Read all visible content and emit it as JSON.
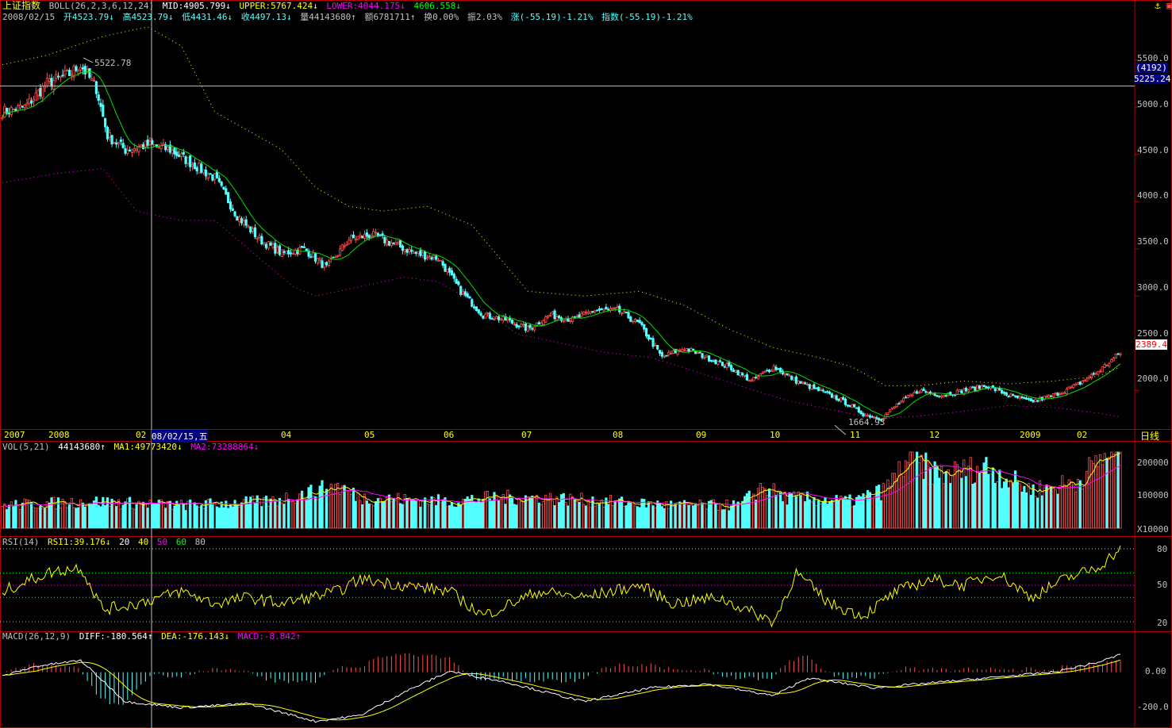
{
  "window": {
    "icons": [
      "anchor-icon",
      "calendar-icon"
    ]
  },
  "header": {
    "index_name": "上证指数",
    "boll_label": "BOLL(26,2,3,6,12,24)",
    "mid": "MID:4905.799↓",
    "upper": "UPPER:5767.424↓",
    "lower": "LOWER:4044.175↓",
    "extra": "4606.558↓",
    "date": "2008/02/15",
    "open": "开4523.79↓",
    "high": "高4523.79↓",
    "low": "低4431.46↓",
    "close": "收4497.13↓",
    "volume": "量44143680↑",
    "amount": "额6781711↑",
    "turnover": "换0.00%",
    "amplitude": "振2.03%",
    "change": "涨(-55.19)-1.21%",
    "index_change": "指数(-55.19)-1.21%"
  },
  "price_axis": {
    "ticks": [
      "5500.0",
      "5000.0",
      "4500.0",
      "4000.0",
      "3500.0",
      "3000.0",
      "2500.0",
      "2000.0"
    ],
    "cursor_box_top": "(4192)",
    "cursor_box_value": "5225.24",
    "last_price": "2389.4"
  },
  "annotations": {
    "high_label": "5522.78",
    "low_label": "1664.93"
  },
  "time_axis": {
    "labels": [
      "2007",
      "2008",
      "02",
      "04",
      "05",
      "06",
      "07",
      "08",
      "09",
      "10",
      "11",
      "12",
      "2009",
      "02"
    ],
    "cursor_date": "08/02/15,五",
    "period": "日线"
  },
  "vol_panel": {
    "title": "VOL(5,21)",
    "value": "44143680↑",
    "ma1": "MA1:49773420↓",
    "ma2": "MA2:73288864↓",
    "ticks": [
      "200000",
      "100000"
    ],
    "unit": "X10000"
  },
  "rsi_panel": {
    "title": "RSI(14)",
    "rsi1": "RSI1:39.176↓",
    "levels_text": [
      "20",
      "40",
      "50",
      "60",
      "80"
    ],
    "ticks": [
      "80",
      "50",
      "20"
    ]
  },
  "macd_panel": {
    "title": "MACD(26,12,9)",
    "diff": "DIFF:-180.564↑",
    "dea": "DEA:-176.143↓",
    "macd": "MACD:-8.842↑",
    "ticks": [
      "0.00",
      "-200.0"
    ]
  },
  "colors": {
    "up": "#ff5050",
    "down": "#54ffff",
    "mid": "#00e000",
    "upper": "#ffff00",
    "lower": "#ff00ff",
    "grid": "#b00000"
  },
  "chart_data": {
    "type": "candlestick",
    "price_anchors": [
      [
        0,
        4950
      ],
      [
        10,
        5000
      ],
      [
        20,
        5250
      ],
      [
        30,
        5350
      ],
      [
        35,
        5450
      ],
      [
        42,
        5200
      ],
      [
        47,
        4700
      ],
      [
        55,
        4550
      ],
      [
        65,
        4600
      ],
      [
        75,
        4550
      ],
      [
        85,
        4400
      ],
      [
        95,
        4250
      ],
      [
        105,
        3850
      ],
      [
        115,
        3600
      ],
      [
        125,
        3450
      ],
      [
        135,
        3500
      ],
      [
        145,
        3300
      ],
      [
        155,
        3600
      ],
      [
        165,
        3650
      ],
      [
        175,
        3550
      ],
      [
        185,
        3450
      ],
      [
        195,
        3400
      ],
      [
        205,
        3050
      ],
      [
        215,
        2800
      ],
      [
        225,
        2750
      ],
      [
        235,
        2650
      ],
      [
        245,
        2800
      ],
      [
        255,
        2750
      ],
      [
        265,
        2850
      ],
      [
        275,
        2850
      ],
      [
        285,
        2700
      ],
      [
        295,
        2350
      ],
      [
        305,
        2450
      ],
      [
        315,
        2350
      ],
      [
        325,
        2250
      ],
      [
        335,
        2100
      ],
      [
        345,
        2250
      ],
      [
        355,
        2100
      ],
      [
        365,
        2000
      ],
      [
        375,
        1900
      ],
      [
        385,
        1750
      ],
      [
        393,
        1700
      ],
      [
        400,
        1850
      ],
      [
        410,
        2000
      ],
      [
        420,
        1950
      ],
      [
        430,
        2000
      ],
      [
        440,
        2050
      ],
      [
        450,
        1950
      ],
      [
        460,
        1880
      ],
      [
        470,
        1950
      ],
      [
        480,
        2050
      ],
      [
        490,
        2200
      ],
      [
        500,
        2400
      ]
    ],
    "boll_upper_anchors": [
      [
        0,
        5450
      ],
      [
        20,
        5550
      ],
      [
        45,
        5750
      ],
      [
        65,
        5850
      ],
      [
        80,
        5650
      ],
      [
        95,
        4950
      ],
      [
        110,
        4750
      ],
      [
        125,
        4550
      ],
      [
        140,
        4150
      ],
      [
        155,
        3950
      ],
      [
        170,
        3900
      ],
      [
        190,
        3950
      ],
      [
        210,
        3750
      ],
      [
        235,
        3050
      ],
      [
        260,
        3000
      ],
      [
        285,
        3050
      ],
      [
        305,
        2900
      ],
      [
        325,
        2650
      ],
      [
        345,
        2450
      ],
      [
        365,
        2350
      ],
      [
        380,
        2250
      ],
      [
        395,
        2050
      ],
      [
        410,
        2050
      ],
      [
        430,
        2100
      ],
      [
        450,
        2070
      ],
      [
        470,
        2100
      ],
      [
        490,
        2150
      ],
      [
        500,
        2250
      ]
    ],
    "boll_lower_anchors": [
      [
        0,
        4200
      ],
      [
        25,
        4300
      ],
      [
        45,
        4350
      ],
      [
        60,
        3900
      ],
      [
        80,
        3800
      ],
      [
        95,
        3800
      ],
      [
        115,
        3400
      ],
      [
        130,
        3100
      ],
      [
        140,
        3000
      ],
      [
        160,
        3100
      ],
      [
        180,
        3200
      ],
      [
        195,
        3150
      ],
      [
        210,
        2950
      ],
      [
        230,
        2600
      ],
      [
        250,
        2500
      ],
      [
        270,
        2400
      ],
      [
        290,
        2350
      ],
      [
        310,
        2200
      ],
      [
        330,
        2050
      ],
      [
        350,
        1900
      ],
      [
        370,
        1800
      ],
      [
        390,
        1700
      ],
      [
        410,
        1730
      ],
      [
        430,
        1780
      ],
      [
        450,
        1840
      ],
      [
        470,
        1820
      ],
      [
        490,
        1760
      ],
      [
        500,
        1720
      ]
    ],
    "volume_level_anchors": [
      [
        0,
        0.3
      ],
      [
        40,
        0.35
      ],
      [
        80,
        0.3
      ],
      [
        120,
        0.35
      ],
      [
        150,
        0.55
      ],
      [
        160,
        0.4
      ],
      [
        200,
        0.35
      ],
      [
        220,
        0.4
      ],
      [
        240,
        0.4
      ],
      [
        270,
        0.35
      ],
      [
        300,
        0.3
      ],
      [
        330,
        0.3
      ],
      [
        340,
        0.55
      ],
      [
        350,
        0.4
      ],
      [
        380,
        0.35
      ],
      [
        395,
        0.5
      ],
      [
        405,
        0.9
      ],
      [
        420,
        0.7
      ],
      [
        440,
        0.8
      ],
      [
        460,
        0.5
      ],
      [
        480,
        0.6
      ],
      [
        495,
        1.0
      ],
      [
        500,
        1.0
      ]
    ],
    "rsi_anchors": [
      [
        0,
        45
      ],
      [
        20,
        60
      ],
      [
        35,
        65
      ],
      [
        45,
        30
      ],
      [
        60,
        35
      ],
      [
        80,
        45
      ],
      [
        95,
        35
      ],
      [
        110,
        40
      ],
      [
        125,
        35
      ],
      [
        150,
        45
      ],
      [
        160,
        55
      ],
      [
        180,
        50
      ],
      [
        200,
        45
      ],
      [
        215,
        25
      ],
      [
        240,
        45
      ],
      [
        260,
        40
      ],
      [
        285,
        50
      ],
      [
        300,
        35
      ],
      [
        320,
        40
      ],
      [
        345,
        20
      ],
      [
        355,
        60
      ],
      [
        370,
        35
      ],
      [
        385,
        25
      ],
      [
        400,
        45
      ],
      [
        415,
        55
      ],
      [
        430,
        50
      ],
      [
        445,
        60
      ],
      [
        460,
        40
      ],
      [
        475,
        55
      ],
      [
        490,
        65
      ],
      [
        500,
        80
      ]
    ],
    "macd_diff_anchors": [
      [
        0,
        -20
      ],
      [
        15,
        30
      ],
      [
        35,
        60
      ],
      [
        55,
        -150
      ],
      [
        80,
        -180
      ],
      [
        110,
        -160
      ],
      [
        140,
        -250
      ],
      [
        160,
        -220
      ],
      [
        180,
        -100
      ],
      [
        200,
        5
      ],
      [
        225,
        -50
      ],
      [
        260,
        -150
      ],
      [
        290,
        -80
      ],
      [
        315,
        -60
      ],
      [
        345,
        -120
      ],
      [
        360,
        -30
      ],
      [
        390,
        -80
      ],
      [
        420,
        -50
      ],
      [
        450,
        -20
      ],
      [
        470,
        0
      ],
      [
        490,
        50
      ],
      [
        500,
        90
      ]
    ],
    "boll_mid": 4905.799,
    "boll_upper": 5767.424,
    "boll_lower": 4044.175,
    "high": 5522.78,
    "low": 1664.93,
    "last": 2389.4,
    "price_range": [
      1600,
      5900
    ],
    "rsi_levels": [
      20,
      50,
      80
    ],
    "macd_range": [
      -260,
      160
    ]
  }
}
